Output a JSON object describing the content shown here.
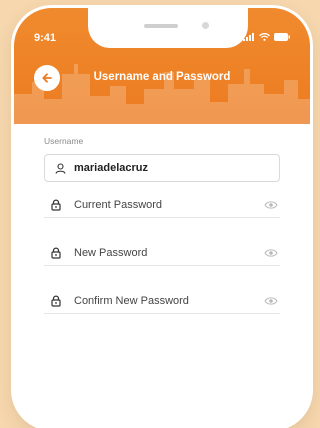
{
  "status_bar": {
    "time": "9:41"
  },
  "header": {
    "title": "Username and Password"
  },
  "username": {
    "label": "Username",
    "value": "mariadelacruz"
  },
  "fields": [
    {
      "placeholder": "Current Password"
    },
    {
      "placeholder": "New Password"
    },
    {
      "placeholder": "Confirm New Password"
    }
  ],
  "colors": {
    "accent": "#ec7b20",
    "background": "#f6d7ae"
  },
  "icons": [
    "back-arrow-icon",
    "user-icon",
    "lock-icon",
    "eye-icon",
    "signal-icon",
    "wifi-icon",
    "battery-icon"
  ]
}
